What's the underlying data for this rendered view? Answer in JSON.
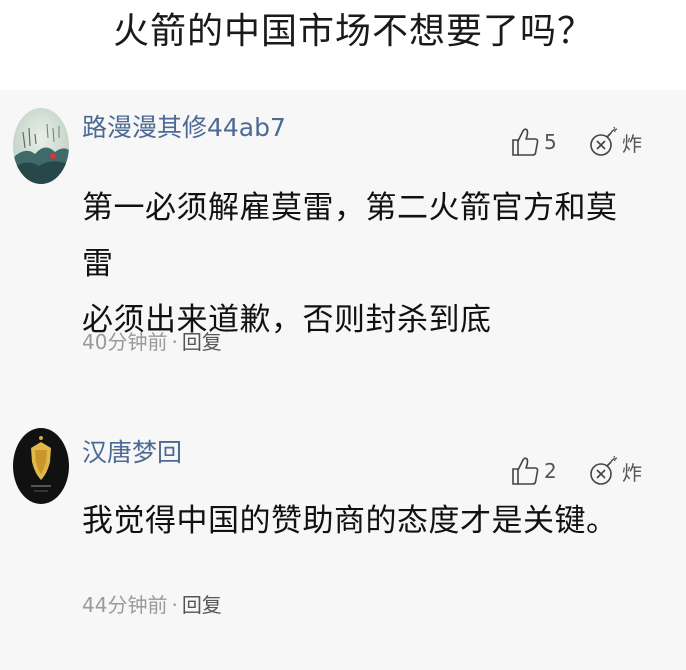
{
  "post": {
    "title": "火箭的中国市场不想要了吗？"
  },
  "comments": [
    {
      "username": "路漫漫其修44ab7",
      "likes": "5",
      "bomb_label": "炸",
      "text_lines": [
        "第一必须解雇莫雷，第二火箭官方和莫雷",
        "必须出来道歉，否则封杀到底"
      ],
      "time": "40分钟前",
      "separator": "·",
      "reply_label": "回复"
    },
    {
      "username": "汉唐梦回",
      "likes": "2",
      "bomb_label": "炸",
      "text_lines": [
        "我觉得中国的赞助商的态度才是关键。"
      ],
      "time": "44分钟前",
      "separator": "·",
      "reply_label": "回复"
    }
  ],
  "colors": {
    "username": "#4d6a93",
    "comment_bg": "#f7f7f7",
    "meta": "#9a9a9a"
  },
  "icons": {
    "like": "thumbs-up-icon",
    "bomb": "bomb-icon"
  }
}
